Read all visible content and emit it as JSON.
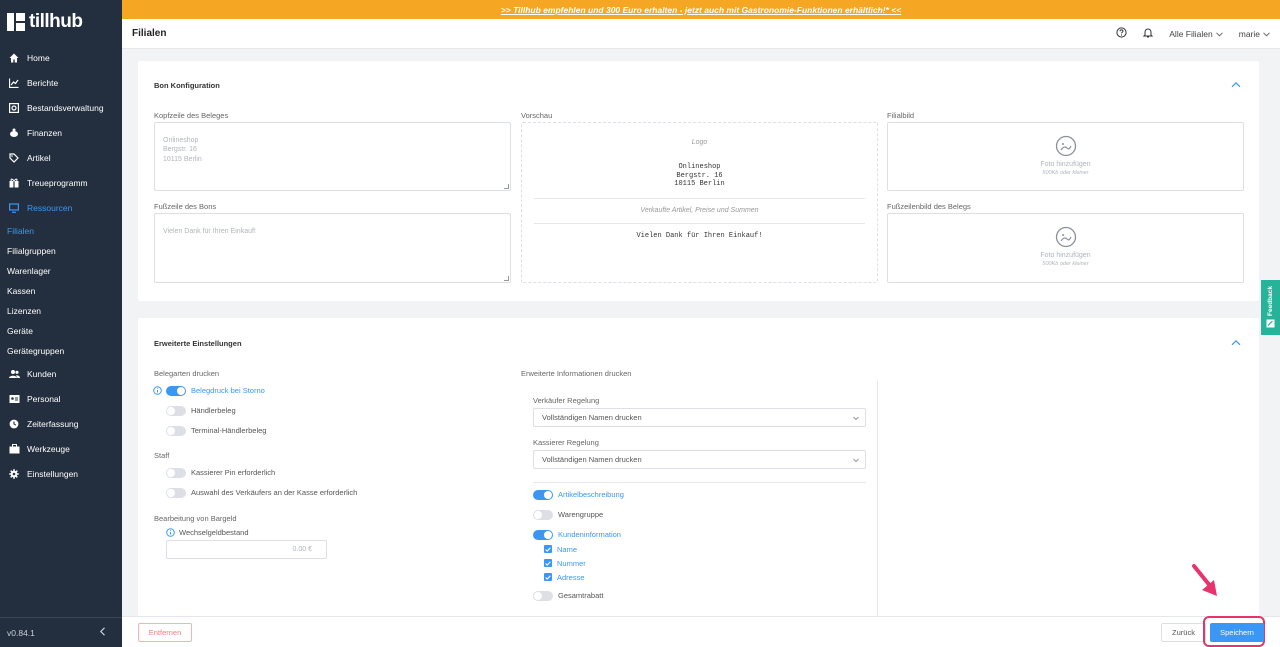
{
  "banner": {
    "text": ">> Tillhub empfehlen und 300 Euro erhalten - jetzt auch mit Gastronomie-Funktionen erhältlich!* <<",
    "color": "#f5a623"
  },
  "brand": {
    "logo_text": "tillhub"
  },
  "sidebar": {
    "items": [
      {
        "label": "Home",
        "icon": "home-icon"
      },
      {
        "label": "Berichte",
        "icon": "chart-icon"
      },
      {
        "label": "Bestandsverwaltung",
        "icon": "inventory-icon"
      },
      {
        "label": "Finanzen",
        "icon": "piggy-bank-icon"
      },
      {
        "label": "Artikel",
        "icon": "tag-icon"
      },
      {
        "label": "Treueprogramm",
        "icon": "gift-icon"
      },
      {
        "label": "Ressourcen",
        "icon": "monitor-icon"
      }
    ],
    "subitems": [
      {
        "label": "Filialen"
      },
      {
        "label": "Filialgruppen"
      },
      {
        "label": "Warenlager"
      },
      {
        "label": "Kassen"
      },
      {
        "label": "Lizenzen"
      },
      {
        "label": "Geräte"
      },
      {
        "label": "Gerätegruppen"
      }
    ],
    "items2": [
      {
        "label": "Kunden",
        "icon": "users-icon"
      },
      {
        "label": "Personal",
        "icon": "id-card-icon"
      },
      {
        "label": "Zeiterfassung",
        "icon": "clock-icon"
      },
      {
        "label": "Werkzeuge",
        "icon": "tools-icon"
      },
      {
        "label": "Einstellungen",
        "icon": "gear-icon"
      }
    ],
    "version": "v0.84.1",
    "accent": "#3b97f5"
  },
  "header": {
    "title": "Filialen",
    "branch_select": "Alle Filialen",
    "user": "marie"
  },
  "bon": {
    "title": "Bon Konfiguration",
    "kopf_label": "Kopfzeile des Beleges",
    "kopf_placeholder": "Onlineshop\nBergstr. 16\n10115 Berlin",
    "fuss_label": "Fußzeile des Bons",
    "fuss_placeholder": "Vielen Dank für Ihren Einkauf!",
    "vorschau_label": "Vorschau",
    "preview_logo": "Logo",
    "preview_address": "Onlineshop\nBergstr. 16\n10115 Berlin",
    "preview_items": "Verkaufte Artikel, Preise und Summen",
    "preview_footer": "Vielen Dank für Ihren Einkauf!",
    "filialbild_label": "Filialbild",
    "fusszeilenbild_label": "Fußzeilenbild des Belegs",
    "photo_add": "Foto hinzufügen",
    "photo_hint": "500Kb oder kleiner"
  },
  "erweitert": {
    "title": "Erweiterte Einstellungen",
    "belegarten_label": "Belegarten drucken",
    "belegarten": [
      {
        "label": "Belegdruck bei Storno",
        "on": true
      },
      {
        "label": "Händlerbeleg",
        "on": false
      },
      {
        "label": "Terminal-Händlerbeleg",
        "on": false
      }
    ],
    "staff_label": "Staff",
    "staff": [
      {
        "label": "Kassierer Pin erforderlich",
        "on": false
      },
      {
        "label": "Auswahl des Verkäufers an der Kasse erforderlich",
        "on": false
      }
    ],
    "bargeld_label": "Bearbeitung von Bargeld",
    "wechselgeld_label": "Wechselgeldbestand",
    "wechselgeld_value": "0.00 €",
    "info_label": "Erweiterte Informationen drucken",
    "verkaeufer_label": "Verkäufer Regelung",
    "verkaeufer_value": "Vollständigen Namen drucken",
    "kassierer_label": "Kassierer Regelung",
    "kassierer_value": "Vollständigen Namen drucken",
    "info_toggles": [
      {
        "label": "Artikelbeschreibung",
        "on": true
      },
      {
        "label": "Warengruppe",
        "on": false
      },
      {
        "label": "Kundeninformation",
        "on": true
      }
    ],
    "kunden_checks": [
      "Name",
      "Nummer",
      "Adresse"
    ],
    "gesamtrabatt": {
      "label": "Gesamtrabatt",
      "on": false
    }
  },
  "footer": {
    "remove": "Entfernen",
    "back": "Zurück",
    "save": "Speichern",
    "highlight_color": "#e8336d"
  },
  "feedback": {
    "label": "Feedback"
  }
}
